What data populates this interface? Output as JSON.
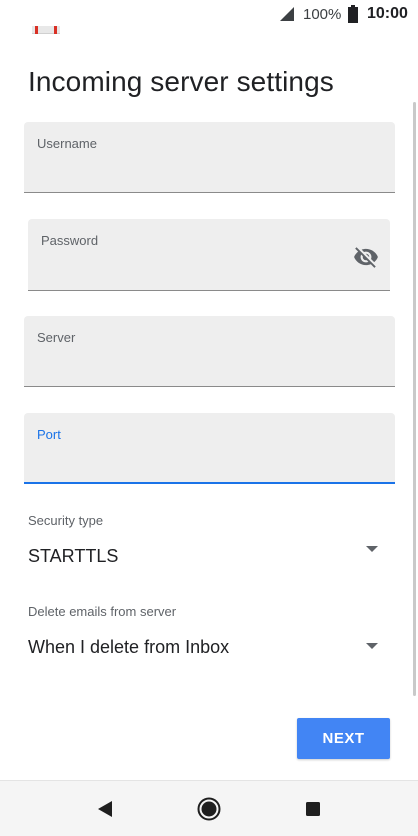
{
  "status_bar": {
    "battery_percent": "100%",
    "time": "10:00",
    "icons": [
      "app-logo-icon",
      "signal-icon",
      "battery-icon"
    ]
  },
  "title": "Incoming server settings",
  "fields": {
    "username": {
      "label": "Username",
      "value": ""
    },
    "password": {
      "label": "Password",
      "value": "",
      "toggle_icon": "visibility-off-icon"
    },
    "server": {
      "label": "Server",
      "value": ""
    },
    "port": {
      "label": "Port",
      "value": ""
    }
  },
  "security_type": {
    "label": "Security type",
    "value": "STARTTLS",
    "icon": "dropdown-arrow-icon"
  },
  "delete_emails": {
    "label": "Delete emails from server",
    "value": "When I delete from Inbox",
    "icon": "dropdown-arrow-icon"
  },
  "next_button": {
    "label": "NEXT"
  },
  "nav_bar": {
    "icons": [
      "back-icon",
      "home-icon",
      "recents-icon"
    ]
  },
  "colors": {
    "accent": "#1a73e8",
    "button": "#4285f4",
    "field_bg": "#eeeeee",
    "text": "#202124",
    "secondary_text": "#5f6368"
  }
}
